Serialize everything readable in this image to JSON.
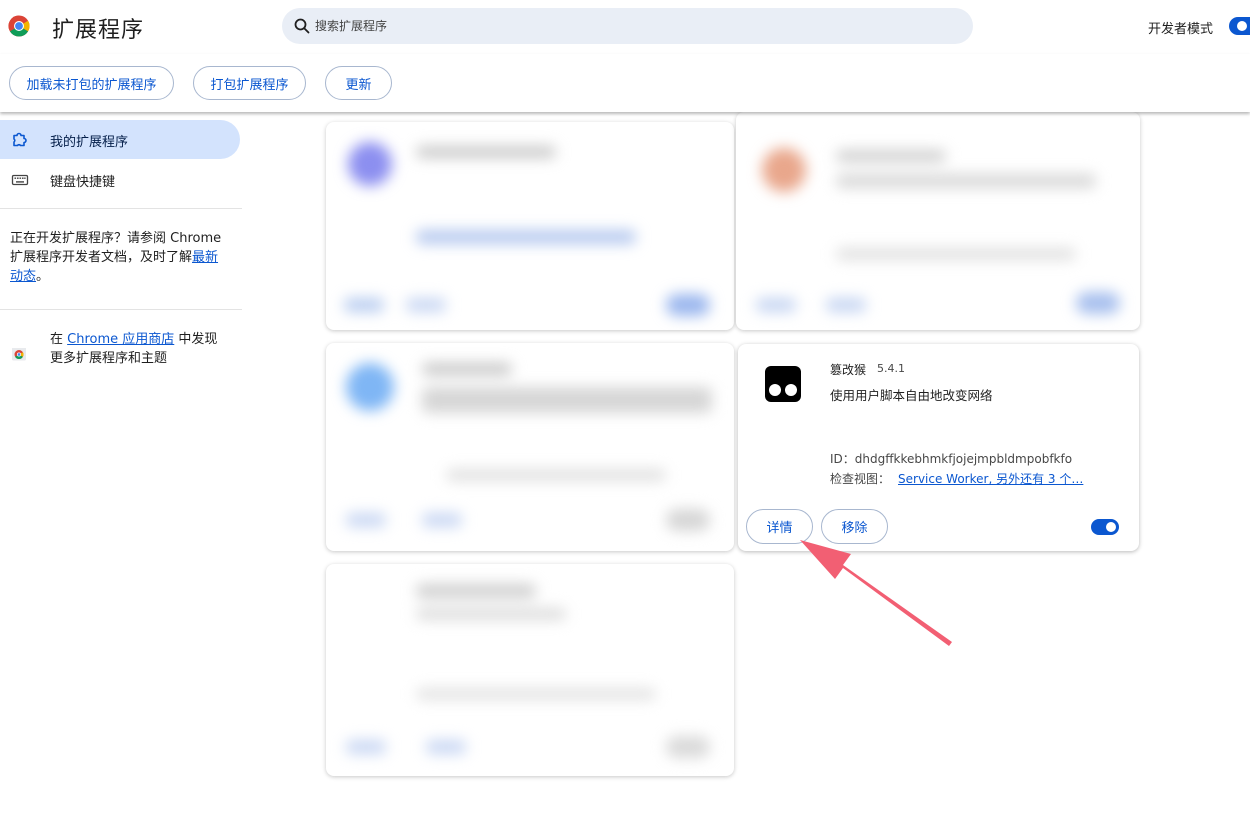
{
  "header": {
    "title": "扩展程序",
    "search_placeholder": "搜索扩展程序",
    "developer_mode_label": "开发者模式",
    "developer_mode_on": true
  },
  "toolbar": {
    "load_unpacked": "加载未打包的扩展程序",
    "pack": "打包扩展程序",
    "update": "更新"
  },
  "sidebar": {
    "items": [
      {
        "label": "我的扩展程序",
        "icon": "extension-icon",
        "active": true
      },
      {
        "label": "键盘快捷键",
        "icon": "keyboard-icon",
        "active": false
      }
    ],
    "dev_text_prefix": "正在开发扩展程序？请参阅 Chrome 扩展程序开发者文档，及时了解",
    "dev_link": "最新动态",
    "dev_text_suffix": "。",
    "store_prefix": "在 ",
    "store_link": "Chrome 应用商店",
    "store_suffix": " 中发现更多扩展程序和主题"
  },
  "extension": {
    "name": "篡改猴",
    "version": "5.4.1",
    "description": "使用用户脚本自由地改变网络",
    "id_label": "ID：",
    "id_value": "dhdgffkkebhmkfjojejmpbldmpobfkfo",
    "inspect_label": "检查视图：",
    "inspect_link": "Service Worker, 另外还有 3 个…",
    "details_button": "详情",
    "remove_button": "移除",
    "enabled": true,
    "logo_icon": "tampermonkey-icon"
  },
  "colors": {
    "accent": "#0b57d0",
    "active_nav_bg": "#d3e3fd",
    "search_bg": "#e9eef6",
    "arrow": "#f25f73"
  }
}
